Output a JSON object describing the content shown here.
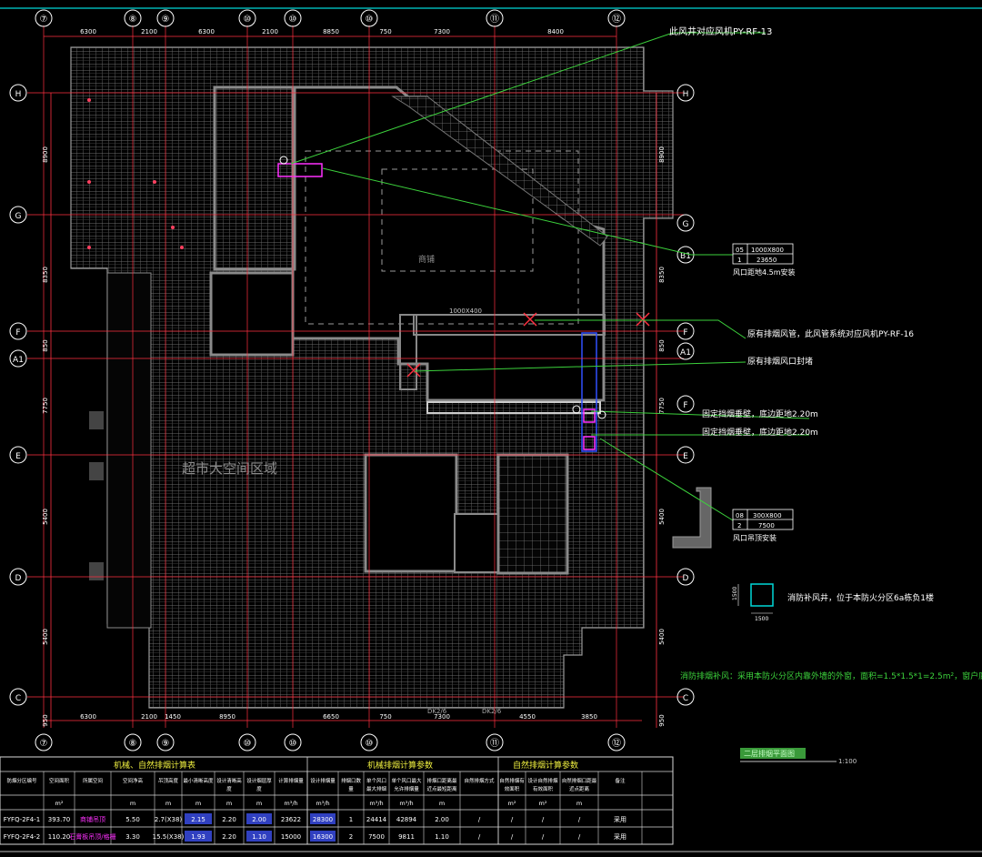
{
  "grid": {
    "top_labels": [
      "⑦",
      "⑧",
      "⑨",
      "⑩",
      "⑩",
      "⑩",
      "⑪",
      "⑫"
    ],
    "top_dims": [
      "6300",
      "2100",
      "6300",
      "2100",
      "8850",
      "750",
      "7300",
      "8400"
    ],
    "bottom_dims": [
      "6300",
      "2100",
      "1450",
      "8950",
      "6650",
      "750",
      "7300",
      "4550",
      "3850"
    ],
    "left_rows": [
      "H",
      "G",
      "F",
      "A1",
      "E",
      "D",
      "C"
    ],
    "right_rows": [
      "H",
      "G",
      "B1",
      "F",
      "A1",
      "E",
      "D",
      "C"
    ],
    "left_dims": [
      "8900",
      "8350",
      "850",
      "7750",
      "5400",
      "5400",
      "950"
    ],
    "right_dims": [
      "8900",
      "8350",
      "850",
      "7750",
      "5400",
      "5400",
      "950"
    ]
  },
  "callouts": {
    "top_right": "此风井对应风机PY-RF-13",
    "box1_row1": [
      "05",
      "1000X800"
    ],
    "box1_row2": [
      "1",
      "23650"
    ],
    "box1_note": "风口距地4.5m安装",
    "note_existing_system": "原有排烟风管，此风管系统对应风机PY-RF-16",
    "note_existing_outlet": "原有排烟风口封堵",
    "note_fixed_hang1": "固定挡烟垂壁，底边距地2.20m",
    "note_fixed_hang2": "固定挡烟垂壁，底边距地2.20m",
    "box2_row1": [
      "08",
      "300X800"
    ],
    "box2_row2": [
      "2",
      "7500"
    ],
    "box2_note": "风口吊顶安装",
    "shaft_note": "消防补风井，位于本防火分区6a栋负1楼",
    "shaft_dim_w": "1500",
    "shaft_dim_h": "1500",
    "natural_vent_note": "消防排烟补风：采用本防火分区内靠外墙的外窗，面积=1.5*1.5*1=2.5m²，窗户底边",
    "duct_label": "1000X400",
    "room_label": "超市大空间区域",
    "center_label": "商铺",
    "plan_title": "二层排烟平面图",
    "scale": "1:100",
    "dk_labels": [
      "DK2/6",
      "DK2/6"
    ]
  },
  "table": {
    "group1_title": "机械、自然排烟计算表",
    "group2_title": "机械排烟计算参数",
    "group3_title": "自然排烟计算参数",
    "headers": [
      "防烟分区编号",
      "空间面积",
      "所属空间",
      "空间净高",
      "吊顶高度",
      "最小清晰高度",
      "设计清晰高度",
      "设计烟层厚度",
      "计算排烟量",
      "设计排烟量",
      "排烟口数量",
      "单个风口最大排烟量",
      "单个风口最大允许排烟量",
      "排烟口距离最近点最短距离",
      "自然排烟方式",
      "自然排烟有效面积",
      "设计自然排烟有效面积",
      "自然排烟口距最近点距离",
      "备注"
    ],
    "units": [
      "",
      "m²",
      "",
      "m",
      "m",
      "m",
      "m",
      "m",
      "m³/h",
      "m³/h",
      "",
      "m³/h",
      "m³/h",
      "m",
      "",
      "m²",
      "m²",
      "m",
      ""
    ],
    "rows": [
      [
        "FYFQ-2F4-1",
        "393.70",
        "商铺吊顶",
        "5.50",
        "2.7(X38)",
        "2.15",
        "2.20",
        "2.00",
        "23622",
        "28300",
        "1",
        "24414",
        "42894",
        "2.00",
        "/",
        "/",
        "/",
        "/",
        "采用"
      ],
      [
        "FYFQ-2F4-2",
        "110.20",
        "石膏板吊顶/格栅",
        "3.30",
        "15.5(X38)",
        "1.93",
        "2.20",
        "1.10",
        "15000",
        "16300",
        "2",
        "7500",
        "9811",
        "1.10",
        "/",
        "/",
        "/",
        "/",
        "采用"
      ]
    ]
  },
  "colors": {
    "cyan": "#00d8d8",
    "red": "#ff3040",
    "green": "#3cd23c",
    "white": "#ffffff",
    "magenta": "#ff30ff",
    "blue": "#2040ff",
    "gray": "#8a8a8a"
  }
}
